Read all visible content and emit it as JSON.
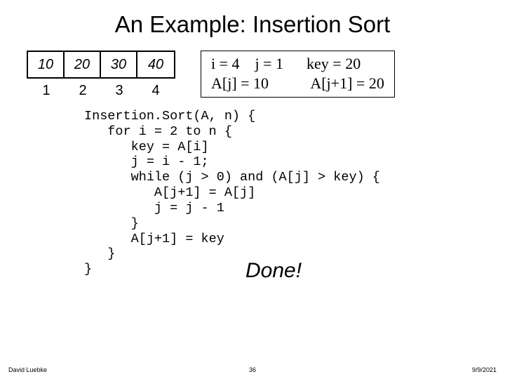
{
  "title": "An Example: Insertion Sort",
  "array": {
    "values": [
      "10",
      "20",
      "30",
      "40"
    ],
    "indices": [
      "1",
      "2",
      "3",
      "4"
    ]
  },
  "state": {
    "line1": "i = 4    j = 1      key = 20",
    "line2": "A[j] = 10           A[j+1] = 20"
  },
  "code": "Insertion.Sort(A, n) {\n   for i = 2 to n {\n      key = A[i]\n      j = i - 1;\n      while (j > 0) and (A[j] > key) {\n         A[j+1] = A[j]\n         j = j - 1\n      }\n      A[j+1] = key\n   }\n}",
  "done": "Done!",
  "footer": {
    "left": "David Luebke",
    "center": "36",
    "right": "9/9/2021"
  }
}
